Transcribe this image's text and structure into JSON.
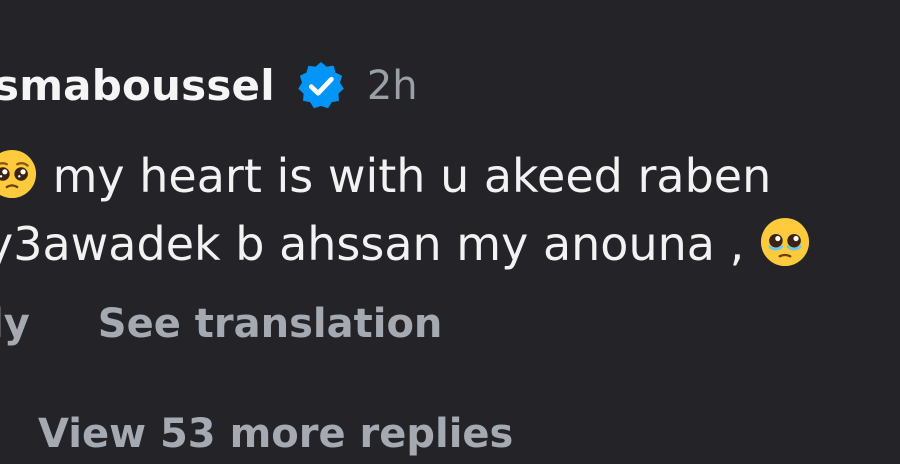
{
  "comment": {
    "username": "smaboussel",
    "time": "2h",
    "line1": "my heart is with u akeed raben",
    "line2": "y3awadek b ahssan my anouna ,",
    "reply_label": "ly",
    "see_translation_label": "See translation",
    "more_replies_label": "View 53 more replies",
    "verified_icon": "verified-badge-icon",
    "emoji_icon": "pleading-face-emoji",
    "emoji_icon_2": "face-holding-back-tears-emoji"
  },
  "colors": {
    "background": "#242428",
    "text_primary": "#f2f2f2",
    "text_secondary": "#a5a9b1",
    "verified_blue": "#0095f6"
  }
}
